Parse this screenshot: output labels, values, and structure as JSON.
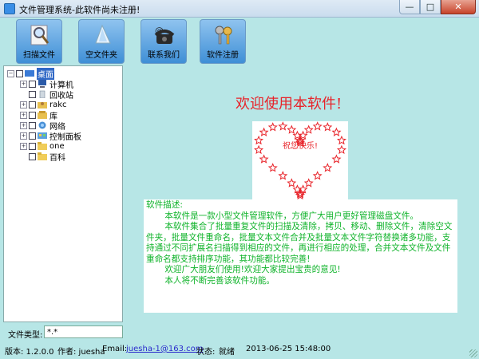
{
  "window": {
    "title": "文件管理系统-此软件尚未注册!",
    "min_glyph": "—",
    "max_glyph": "□",
    "close_glyph": "✕"
  },
  "toolbar": {
    "buttons": [
      {
        "label": "扫描文件",
        "icon": "magnifier-icon"
      },
      {
        "label": "空文件夹",
        "icon": "paper-icon"
      },
      {
        "label": "联系我们",
        "icon": "telephone-icon"
      },
      {
        "label": "软件注册",
        "icon": "keys-icon"
      }
    ]
  },
  "tree": {
    "root": "桌面",
    "items": [
      {
        "label": "计算机",
        "icon": "computer-icon"
      },
      {
        "label": "回收站",
        "icon": "recycle-bin-icon"
      },
      {
        "label": "rakc",
        "icon": "user-folder-icon"
      },
      {
        "label": "库",
        "icon": "library-icon"
      },
      {
        "label": "网络",
        "icon": "network-icon"
      },
      {
        "label": "控制面板",
        "icon": "control-panel-icon"
      },
      {
        "label": "one",
        "icon": "folder-icon"
      },
      {
        "label": "百科",
        "icon": "folder-icon"
      }
    ]
  },
  "file_type": {
    "label": "文件类型:",
    "value": "*.*"
  },
  "main": {
    "welcome": "欢迎使用本软件!",
    "heart_text": "祝您快乐!",
    "description": {
      "heading": "软件描述:",
      "para1": "本软件是一款小型文件管理软件，方便广大用户更好管理磁盘文件。",
      "para2": "本软件集合了批量重复文件的扫描及清除，拷贝、移动、删除文件，清除空文件夹，批量文件重命名，批量文本文件合并及批量文本文件字符替换诸多功能，支持通过不同扩展名扫描得到相应的文件，再进行相应的处理，合并文本文件及文件重命名都支持排序功能，其功能都比较完善!",
      "para3": "欢迎广大朋友们使用!欢迎大家提出宝贵的意见!",
      "para4": "本人将不断完善该软件功能。"
    }
  },
  "status": {
    "version": "版本: 1.2.0.0",
    "author": "作者: juesha",
    "email_label": "Email:",
    "email": "juesha-1@163.com",
    "state_label": "状态:",
    "state": "就绪",
    "datetime": "2013-06-25 15:48:00"
  },
  "colors": {
    "welcome": "#e8242a",
    "description_text": "#0fb32a",
    "star": "#e8242a",
    "background": "#b7e6e6"
  }
}
